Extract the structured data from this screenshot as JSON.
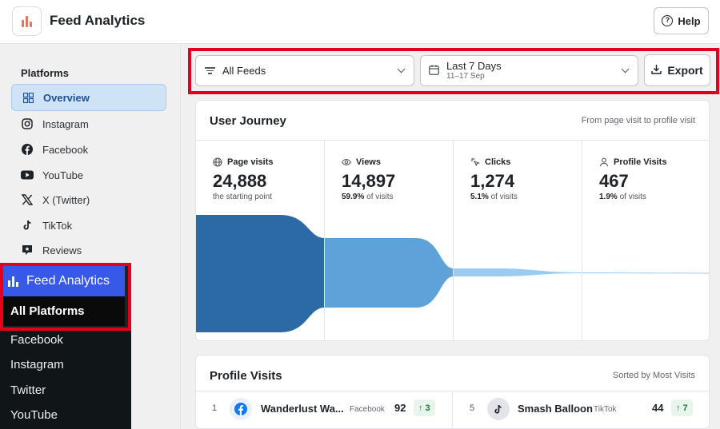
{
  "app": {
    "title": "Feed Analytics"
  },
  "header": {
    "help_label": "Help"
  },
  "sidebar": {
    "heading": "Platforms",
    "items": [
      {
        "label": "Overview",
        "icon": "grid-icon"
      },
      {
        "label": "Instagram",
        "icon": "instagram-icon"
      },
      {
        "label": "Facebook",
        "icon": "facebook-icon"
      },
      {
        "label": "YouTube",
        "icon": "youtube-icon"
      },
      {
        "label": "X (Twitter)",
        "icon": "x-twitter-icon"
      },
      {
        "label": "TikTok",
        "icon": "tiktok-icon"
      },
      {
        "label": "Reviews",
        "icon": "reviews-icon"
      }
    ]
  },
  "wp_menu": {
    "title": "Feed Analytics",
    "active": "All Platforms",
    "items": [
      "Facebook",
      "Instagram",
      "Twitter",
      "YouTube"
    ]
  },
  "toolbar": {
    "feeds_value": "All Feeds",
    "date_value": "Last 7 Days",
    "date_range": "11–17 Sep",
    "export_label": "Export"
  },
  "journey": {
    "title": "User Journey",
    "subtitle": "From page visit to profile visit",
    "stages": [
      {
        "label": "Page visits",
        "value": "24,888",
        "note_strong": "",
        "note": "the starting point",
        "icon": "globe-icon"
      },
      {
        "label": "Views",
        "value": "14,897",
        "note_strong": "59.9%",
        "note": " of visits",
        "icon": "eye-icon"
      },
      {
        "label": "Clicks",
        "value": "1,274",
        "note_strong": "5.1%",
        "note": " of visits",
        "icon": "click-icon"
      },
      {
        "label": "Profile Visits",
        "value": "467",
        "note_strong": "1.9%",
        "note": " of visits",
        "icon": "user-icon"
      }
    ],
    "funnel_colors": [
      "#2c6aa6",
      "#5fa2d9",
      "#9ccbf2"
    ]
  },
  "profile_visits": {
    "title": "Profile Visits",
    "sort_label": "Sorted by Most Visits",
    "rows": [
      {
        "rank": "1",
        "name": "Wanderlust Wa...",
        "platform": "Facebook",
        "count": "92",
        "delta": "↑ 3",
        "icon": "facebook-icon"
      },
      {
        "rank": "5",
        "name": "Smash Balloon",
        "platform": "TikTok",
        "count": "44",
        "delta": "↑ 7",
        "icon": "tiktok-icon"
      }
    ]
  }
}
